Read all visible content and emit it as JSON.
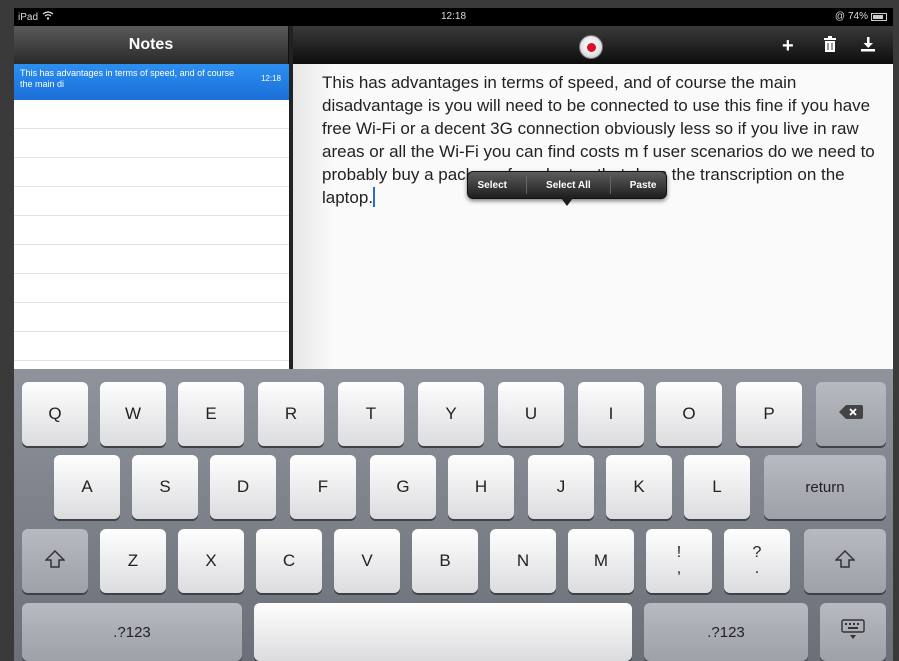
{
  "status": {
    "carrier": "iPad",
    "wifi": "wifi-icon",
    "time": "12:18",
    "alarm": "@",
    "battery_pct": "74%"
  },
  "sidebar": {
    "title": "Notes",
    "selected_note": {
      "preview": "This has advantages in terms of speed, and of course the main di",
      "time": "12:18"
    }
  },
  "toolbar": {
    "record_icon": "record-icon",
    "add_icon": "+",
    "trash_icon": "trash-icon",
    "share_icon": "download-icon"
  },
  "editor": {
    "text": "This has advantages in terms of speed, and of course the main disadvantage is you will need to be connected to use this fine if you have free Wi-Fi or a decent 3G connection obviously less so if you live in raw areas or all the Wi-Fi you can find costs m                       f user scenarios do we need to probably buy a package for a laptop that does the transcription on the laptop."
  },
  "edit_menu": {
    "items": [
      "Select",
      "Select All",
      "Paste"
    ]
  },
  "keyboard": {
    "row1": [
      "Q",
      "W",
      "E",
      "R",
      "T",
      "Y",
      "U",
      "I",
      "O",
      "P"
    ],
    "row2": [
      "A",
      "S",
      "D",
      "F",
      "G",
      "H",
      "J",
      "K",
      "L"
    ],
    "row3": [
      "Z",
      "X",
      "C",
      "V",
      "B",
      "N",
      "M"
    ],
    "punct1": [
      "!",
      ","
    ],
    "punct2": [
      "?",
      "."
    ],
    "return_label": "return",
    "numbers_label": ".?123"
  }
}
